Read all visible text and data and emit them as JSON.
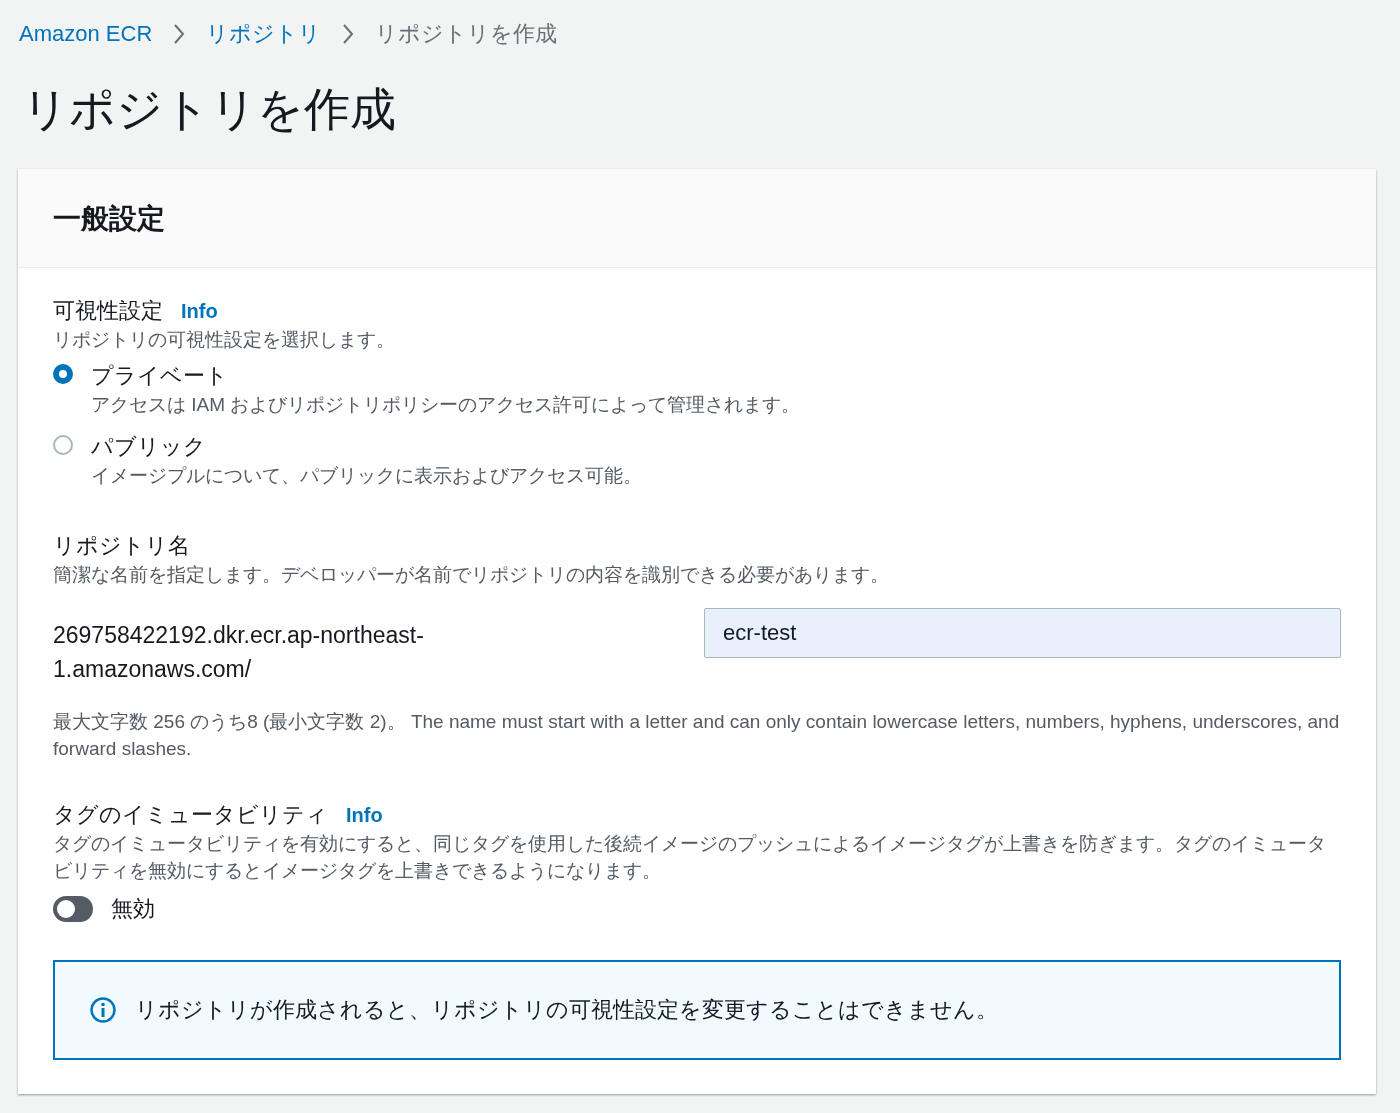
{
  "breadcrumbs": [
    {
      "label": "Amazon ECR",
      "current": false
    },
    {
      "label": "リポジトリ",
      "current": false
    },
    {
      "label": "リポジトリを作成",
      "current": true
    }
  ],
  "title": "リポジトリを作成",
  "section": {
    "title": "一般設定",
    "visibility": {
      "label": "可視性設定",
      "info": "Info",
      "description": "リポジトリの可視性設定を選択します。",
      "options": [
        {
          "label": "プライベート",
          "description": "アクセスは IAM およびリポジトリポリシーのアクセス許可によって管理されます。",
          "selected": true
        },
        {
          "label": "パブリック",
          "description": "イメージプルについて、パブリックに表示およびアクセス可能。",
          "selected": false
        }
      ]
    },
    "repository_name": {
      "label": "リポジトリ名",
      "description": "簡潔な名前を指定します。デベロッパーが名前でリポジトリの内容を識別できる必要があります。",
      "prefix": "269758422192.dkr.ecr.ap-northeast-1.amazonaws.com/",
      "value": "ecr-test",
      "hint": "最大文字数 256 のうち8 (最小文字数 2)。 The name must start with a letter and can only contain lowercase letters, numbers, hyphens, underscores, and forward slashes."
    },
    "tag_immutability": {
      "label": "タグのイミュータビリティ",
      "info": "Info",
      "description": "タグのイミュータビリティを有効にすると、同じタグを使用した後続イメージのプッシュによるイメージタグが上書きを防ぎます。タグのイミュータビリティを無効にするとイメージタグを上書きできるようになります。",
      "on": false,
      "state_label": "無効"
    },
    "alert": {
      "text": "リポジトリが作成されると、リポジトリの可視性設定を変更することはできません。"
    }
  }
}
